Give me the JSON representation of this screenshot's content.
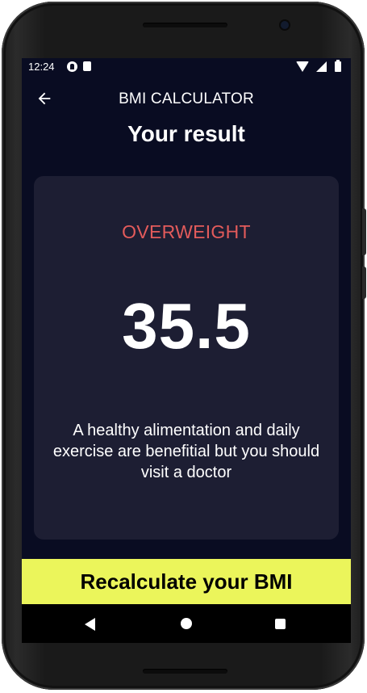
{
  "status_bar": {
    "time": "12:24"
  },
  "app_bar": {
    "back_icon": "arrow-left-icon",
    "title": "BMI CALCULATOR"
  },
  "page": {
    "title": "Your result"
  },
  "result": {
    "status": "OVERWEIGHT",
    "value": "35.5",
    "message": "A healthy alimentation and daily exercise are benefitial but you should visit a doctor"
  },
  "actions": {
    "recalculate_label": "Recalculate your BMI"
  },
  "colors": {
    "background": "#090c22",
    "card": "#1d1e33",
    "status_overweight": "#e35b5b",
    "button_accent": "#ebf55b"
  },
  "nav_bar": {
    "icons": [
      "nav-back-icon",
      "nav-home-icon",
      "nav-recents-icon"
    ]
  }
}
